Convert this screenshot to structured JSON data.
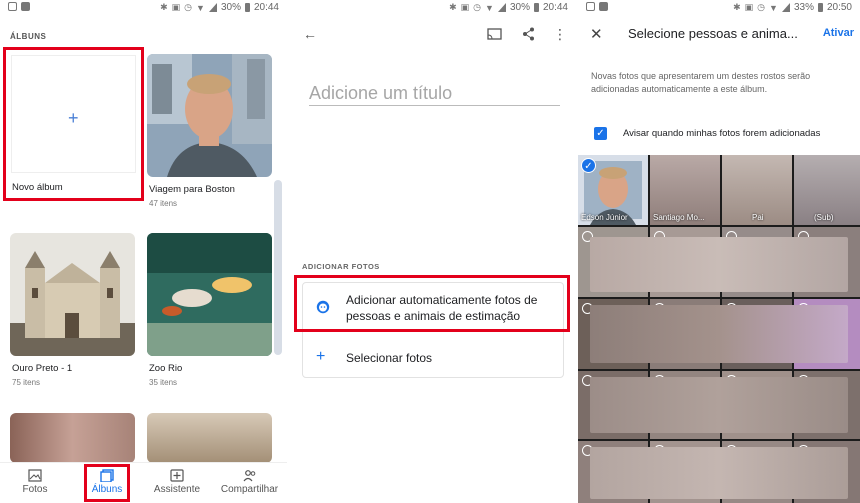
{
  "panels": {
    "albums": {
      "status": {
        "battery": "30%",
        "time": "20:44"
      },
      "section_label": "ÁLBUNS",
      "new_album": {
        "label": "Novo álbum"
      },
      "albums": [
        {
          "name": "Viagem para Boston",
          "count": "47 itens"
        },
        {
          "name": "Ouro Preto - 1",
          "count": "75 itens"
        },
        {
          "name": "Zoo Rio",
          "count": "35 itens"
        }
      ],
      "bottom_nav": [
        {
          "label": "Fotos",
          "icon": "photo-icon"
        },
        {
          "label": "Álbuns",
          "icon": "albums-icon",
          "active": true
        },
        {
          "label": "Assistente",
          "icon": "assistant-icon"
        },
        {
          "label": "Compartilhar",
          "icon": "share-people-icon"
        }
      ]
    },
    "new_album_editor": {
      "status": {
        "battery": "30%",
        "time": "20:44"
      },
      "title_placeholder": "Adicione um título",
      "section_label": "ADICIONAR FOTOS",
      "options": [
        {
          "label": "Adicionar automaticamente fotos de pessoas e animais de estimação",
          "icon": "face-icon"
        },
        {
          "label": "Selecionar fotos",
          "icon": "plus-icon"
        }
      ]
    },
    "select_people": {
      "status": {
        "battery": "33%",
        "time": "20:50"
      },
      "title": "Selecione pessoas e anima...",
      "action": "Ativar",
      "description": "Novas fotos que apresentarem um destes rostos serão adicionadas automaticamente a este álbum.",
      "checkbox_label": "Avisar quando minhas fotos forem adicionadas",
      "faces": [
        {
          "name": "Edson Júnior",
          "selected": true
        },
        {
          "name": "Santiago Mo...",
          "selected": false
        },
        {
          "name": "Pai",
          "selected": false
        },
        {
          "name": "(Sub)",
          "selected": false
        }
      ]
    }
  },
  "colors": {
    "accent": "#1a73e8",
    "highlight": "#e3001b"
  }
}
